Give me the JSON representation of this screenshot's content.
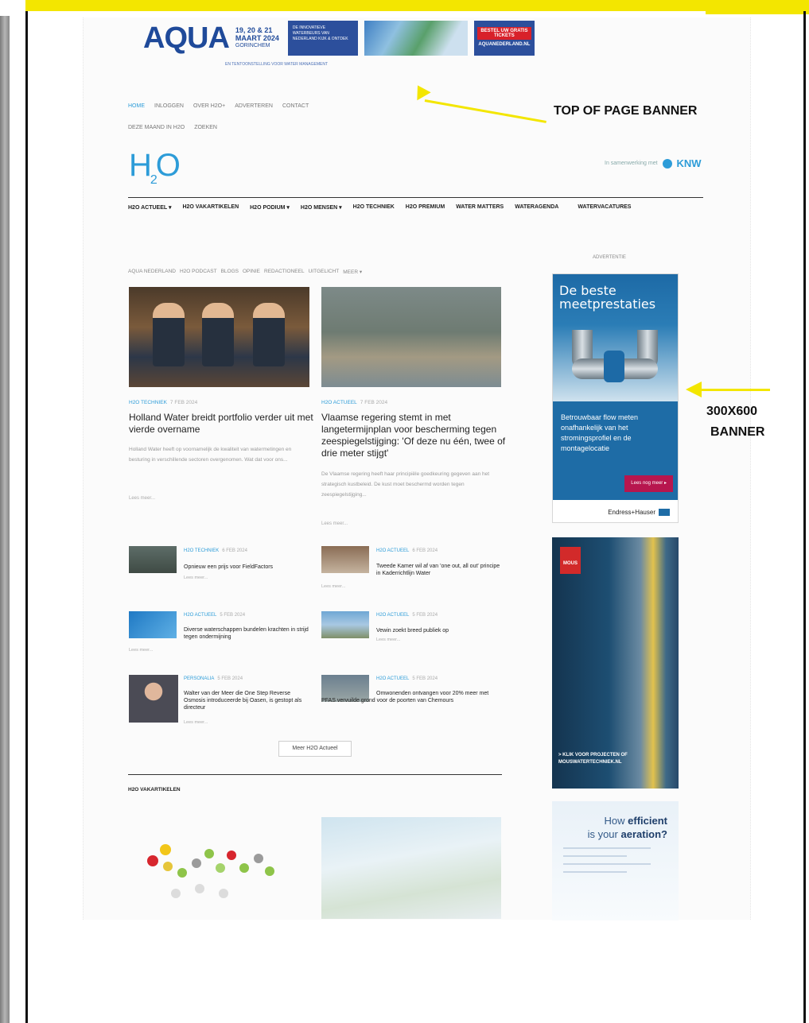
{
  "banner": {
    "brand": "AQUA",
    "subline": "EN TENTOONSTELLING VOOR WATER MANAGEMENT",
    "date_line1": "19, 20 & 21",
    "date_line2": "MAART 2024",
    "venue": "GORINCHEM",
    "box_text": "DE INNOVATIEVE WATERBEURS VAN NEDERLAND KIJK & ONTDEK",
    "cta_label": "BESTEL UW GRATIS TICKETS",
    "cta_sub": "AQUANEDERLAND.NL"
  },
  "subnav": {
    "row1": [
      "HOME",
      "INLOGGEN",
      "OVER H2O+",
      "ADVERTEREN",
      "CONTACT"
    ],
    "row2": [
      "DEZE MAAND IN H2O",
      "ZOEKEN"
    ]
  },
  "logo": {
    "text": "H",
    "sub": "2",
    "tail": "O"
  },
  "partner": {
    "label": "In samenwerking met",
    "name": "KNW"
  },
  "mainnav": [
    "H2O ACTUEEL ▾",
    "H2O VAKARTIKELEN",
    "H2O PODIUM ▾",
    "H2O MENSEN ▾",
    "H2O TECHNIEK",
    "H2O PREMIUM",
    "WATER MATTERS",
    "WATERAGENDA",
    "WATERVACATURES"
  ],
  "catlinks": [
    "AQUA NEDERLAND",
    "H2O PODCAST",
    "BLOGS",
    "OPINIE",
    "REDACTIONEEL",
    "UITGELICHT",
    "MEER ▾"
  ],
  "sidebar_label": "ADVERTENTIE",
  "featured": [
    {
      "category": "H2O TECHNIEK",
      "date": "7 FEB 2024",
      "title": "Holland Water breidt portfolio verder uit met vierde overname",
      "excerpt": "Holland Water heeft op voornamelijk de kwaliteit van watermetingen en besturing in verschillende sectoren overgenomen. Wat dat voor ons...",
      "more": "Lees meer..."
    },
    {
      "category": "H2O ACTUEEL",
      "date": "7 FEB 2024",
      "title": "Vlaamse regering stemt in met langetermijnplan voor bescherming tegen zeespiegelstijging: 'Of deze nu één, twee of drie meter stijgt'",
      "excerpt": "De Vlaamse regering heeft haar principiële goedkeuring gegeven aan het strategisch kustbeleid. De kust moet beschermd worden tegen zeespiegelstijging...",
      "more": "Lees meer..."
    }
  ],
  "list": [
    {
      "category": "H2O TECHNIEK",
      "date": "6 FEB 2024",
      "title": "Opnieuw een prijs voor FieldFactors",
      "more": "Lees meer..."
    },
    {
      "category": "H2O ACTUEEL",
      "date": "6 FEB 2024",
      "title": "Tweede Kamer wil af van 'one out, all out' principe in Kaderrichtlijn Water",
      "more": "Lees meer..."
    },
    {
      "category": "H2O ACTUEEL",
      "date": "5 FEB 2024",
      "title": "Diverse waterschappen bundelen krachten in strijd tegen ondermijning",
      "more": "Lees meer..."
    },
    {
      "category": "H2O ACTUEEL",
      "date": "5 FEB 2024",
      "title": "Vewin zoekt breed publiek op",
      "more": "Lees meer..."
    },
    {
      "category": "PERSONALIA",
      "date": "5 FEB 2024",
      "title": "Walter van der Meer die One Step Reverse Osmosis introduceerde bij Oasen, is gestopt als directeur",
      "more": "Lees meer..."
    },
    {
      "category": "H2O ACTUEEL",
      "date": "5 FEB 2024",
      "title": "Omwonenden ontvangen voor 20% meer met PFAS vervuilde grond voor de poorten van Chemours",
      "more": "Lees meer..."
    }
  ],
  "more_button": "Meer H2O Actueel",
  "section_head": "H2O VAKARTIKELEN",
  "ad_eh": {
    "title": "De beste meetprestaties",
    "body": "Betrouwbaar flow meten onafhankelijk van het stromingsprofiel en de montagelocatie",
    "button": "Lees nog meer ▸",
    "brand": "Endress+Hauser"
  },
  "ad_mous": {
    "logo": "MOUS",
    "text": "> KLIK VOOR PROJECTEN OF MOUSWATERTECHNIEK.NL"
  },
  "ad_aer": {
    "line1": "How ",
    "bold1": "efficient",
    "line2": "is your ",
    "bold2": "aeration?"
  },
  "annotations": {
    "top": "TOP OF PAGE BANNER",
    "side_1": "300X600",
    "side_2": "BANNER"
  },
  "colors": {
    "accent": "#2d9cd8",
    "highlight": "#f3e600",
    "brand_blue": "#1f4a9a"
  }
}
